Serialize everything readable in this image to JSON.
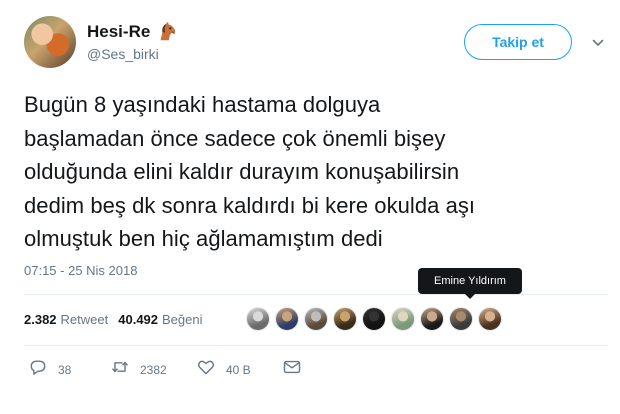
{
  "author": {
    "display_name": "Hesi-Re",
    "handle": "@Ses_birki",
    "emoji_icon": "horse-face-icon"
  },
  "follow_button": {
    "label": "Takip et"
  },
  "tweet": {
    "lines": [
      "Bugün 8 yaşındaki hastama dolguya",
      "başlamadan önce sadece çok önemli bişey",
      "olduğunda elini kaldır durayım konuşabilirsin",
      "dedim beş dk sonra kaldırdı bi kere okulda aşı",
      "olmuştuk ben hiç ağlamamıştım dedi"
    ],
    "timestamp": "07:15 - 25 Nis 2018"
  },
  "stats": {
    "retweets_value": "2.382",
    "retweets_label": "Retweet",
    "likes_value": "40.492",
    "likes_label": "Beğeni"
  },
  "tooltip": {
    "text": "Emine Yıldırım"
  },
  "likers": [
    {
      "color_a": "#6b6b6b",
      "color_b": "#d9d9d9"
    },
    {
      "color_a": "#2c3e66",
      "color_b": "#c8a27a"
    },
    {
      "color_a": "#5a4a3a",
      "color_b": "#bdbdbd"
    },
    {
      "color_a": "#3a2a1a",
      "color_b": "#c9a36d"
    },
    {
      "color_a": "#111111",
      "color_b": "#333333"
    },
    {
      "color_a": "#7a9a7a",
      "color_b": "#e0d6c0"
    },
    {
      "color_a": "#1a1a1a",
      "color_b": "#caa88a"
    },
    {
      "color_a": "#3b3b3b",
      "color_b": "#a68a6a"
    },
    {
      "color_a": "#4a3020",
      "color_b": "#d8b08a"
    }
  ],
  "actions": {
    "reply_count": "38",
    "retweet_count": "2382",
    "like_count": "40 B"
  },
  "colors": {
    "accent": "#1da1f2",
    "text_primary": "#14171a",
    "text_secondary": "#657786",
    "divider": "#e6ecf0"
  }
}
